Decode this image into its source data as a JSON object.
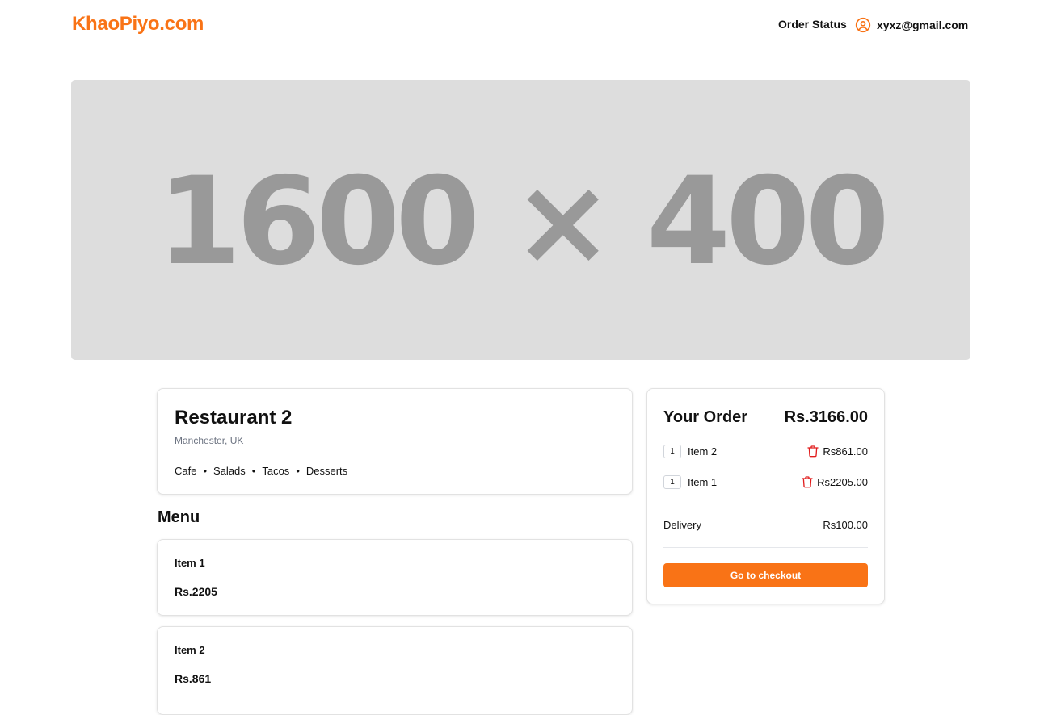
{
  "header": {
    "logo": "KhaoPiyo.com",
    "order_status_label": "Order Status",
    "user_email": "xyxz@gmail.com",
    "user_icon": "user-circle-icon",
    "accent_color": "#f97316"
  },
  "hero": {
    "placeholder_text": "1600 × 400"
  },
  "restaurant": {
    "name": "Restaurant 2",
    "location": "Manchester, UK",
    "cuisines": [
      "Cafe",
      "Salads",
      "Tacos",
      "Desserts"
    ]
  },
  "menu": {
    "heading": "Menu",
    "items": [
      {
        "name": "Item 1",
        "price": "Rs.2205"
      },
      {
        "name": "Item 2",
        "price": "Rs.861"
      }
    ]
  },
  "order": {
    "title": "Your Order",
    "total": "Rs.3166.00",
    "lines": [
      {
        "qty": "1",
        "name": "Item 2",
        "price": "Rs861.00",
        "remove_icon": "trash-icon"
      },
      {
        "qty": "1",
        "name": "Item 1",
        "price": "Rs2205.00",
        "remove_icon": "trash-icon"
      }
    ],
    "delivery_label": "Delivery",
    "delivery_price": "Rs100.00",
    "checkout_label": "Go to checkout"
  }
}
